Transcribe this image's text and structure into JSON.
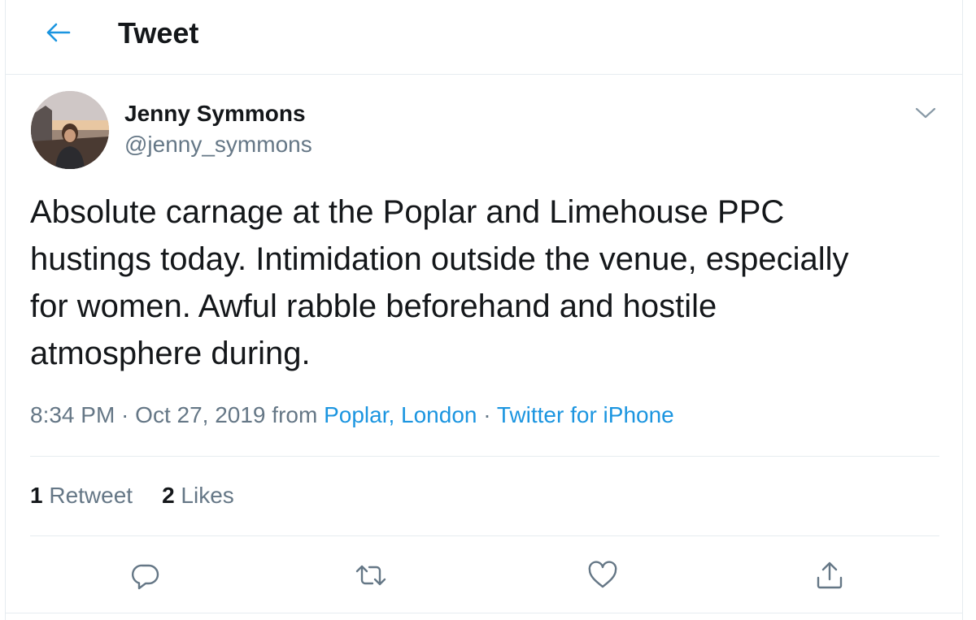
{
  "header": {
    "back_icon": "arrow-left-icon",
    "title": "Tweet"
  },
  "colors": {
    "accent": "#1b95e0",
    "text": "#14171a",
    "secondary": "#657786",
    "border": "#e6ecf0"
  },
  "tweet": {
    "author": {
      "name": "Jenny Symmons",
      "handle": "@jenny_symmons",
      "avatar_icon": "profile-photo"
    },
    "menu_icon": "chevron-down-icon",
    "text": "Absolute carnage at the Poplar and Limehouse PPC\nhustings today. Intimidation outside the venue, especially\nfor women. Awful rabble beforehand and hostile\natmosphere during.",
    "meta": {
      "time": "8:34 PM",
      "sep1": " · ",
      "date": "Oct 27, 2019",
      "from_word": " from ",
      "location": "Poplar, London",
      "sep2": " · ",
      "source": "Twitter for iPhone"
    },
    "stats": {
      "retweets_count": "1",
      "retweets_label": " Retweet",
      "likes_count": "2",
      "likes_label": " Likes"
    },
    "actions": [
      {
        "icon": "reply-icon"
      },
      {
        "icon": "retweet-icon"
      },
      {
        "icon": "like-icon"
      },
      {
        "icon": "share-icon"
      }
    ]
  }
}
